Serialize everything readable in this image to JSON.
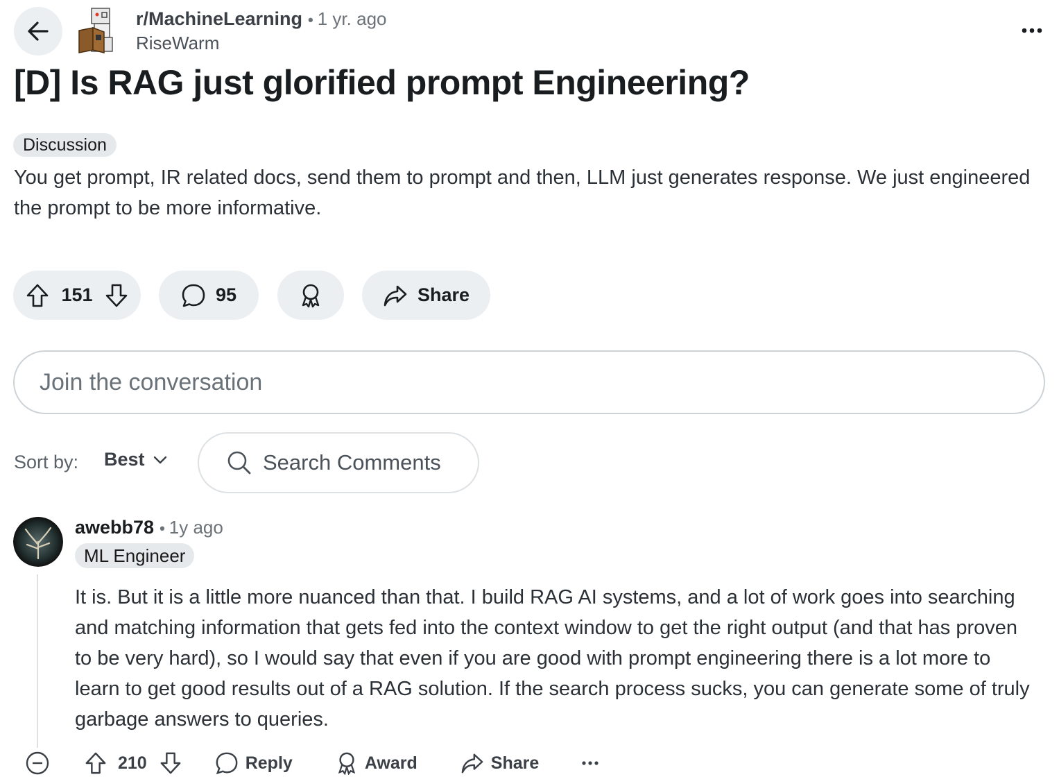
{
  "header": {
    "subreddit": "r/MachineLearning",
    "separator": "•",
    "time": "1 yr. ago",
    "author": "RiseWarm"
  },
  "post": {
    "title": "[D] Is RAG just glorified prompt Engineering?",
    "flair": "Discussion",
    "body": "You get prompt, IR related docs, send them to prompt and then, LLM just generates response. We just engineered the prompt to be more informative."
  },
  "actions": {
    "votes": "151",
    "comments": "95",
    "share_label": "Share"
  },
  "composer": {
    "placeholder": "Join the conversation"
  },
  "sort": {
    "label": "Sort by:",
    "selected": "Best",
    "search_placeholder": "Search Comments"
  },
  "comments": [
    {
      "author": "awebb78",
      "separator": "•",
      "time": "1y ago",
      "flair": "ML Engineer",
      "body": "It is. But it is a little more nuanced than that. I build RAG AI systems, and a lot of work goes into searching and matching information that gets fed into the context window to get the right output (and that has proven to be very hard), so I would say that even if you are good with prompt engineering there is a lot more to learn to get good results out of a RAG solution. If the search process sucks, you can generate some of truly garbage answers to queries.",
      "votes": "210",
      "reply_label": "Reply",
      "award_label": "Award",
      "share_label": "Share"
    }
  ],
  "colors": {
    "pill_bg": "#eceff1",
    "border": "#cdd2d6",
    "text": "#1a1d1f"
  }
}
